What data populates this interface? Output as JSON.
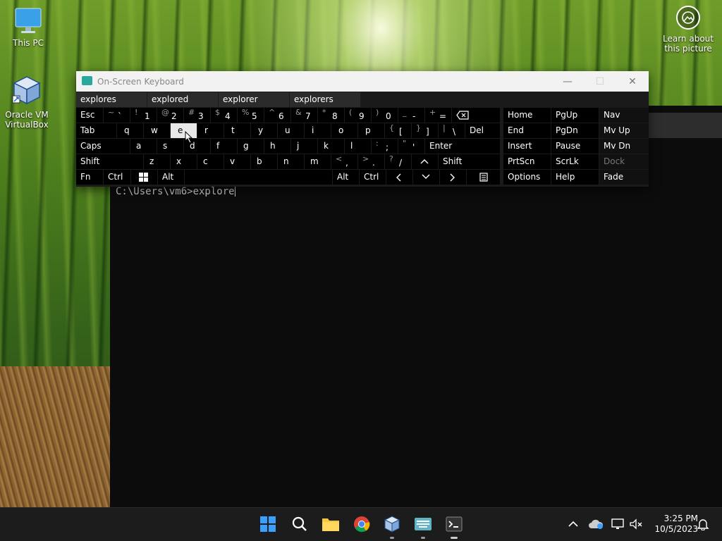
{
  "desktop": {
    "icons": [
      {
        "label": "This PC",
        "icon": "monitor-icon"
      },
      {
        "label": "Oracle VM VirtualBox",
        "icon": "virtualbox-cube-icon"
      }
    ],
    "learn_label": "Learn about this picture"
  },
  "console": {
    "prompt": "C:\\Users\\vm6>",
    "input": "explore"
  },
  "osk": {
    "title": "On-Screen Keyboard",
    "predictions": [
      "explores",
      "explored",
      "explorer",
      "explorers"
    ],
    "row1": {
      "esc": "Esc",
      "keys": [
        {
          "shift": "~",
          "main": "`"
        },
        {
          "shift": "!",
          "main": "1"
        },
        {
          "shift": "@",
          "main": "2"
        },
        {
          "shift": "#",
          "main": "3"
        },
        {
          "shift": "$",
          "main": "4"
        },
        {
          "shift": "%",
          "main": "5"
        },
        {
          "shift": "^",
          "main": "6"
        },
        {
          "shift": "&",
          "main": "7"
        },
        {
          "shift": "*",
          "main": "8"
        },
        {
          "shift": "(",
          "main": "9"
        },
        {
          "shift": ")",
          "main": "0"
        },
        {
          "shift": "_",
          "main": "-"
        },
        {
          "shift": "+",
          "main": "="
        }
      ]
    },
    "row2": {
      "tab": "Tab",
      "letters": [
        "q",
        "w",
        "e",
        "r",
        "t",
        "y",
        "u",
        "i",
        "o",
        "p"
      ],
      "brackets": [
        {
          "shift": "{",
          "main": "["
        },
        {
          "shift": "}",
          "main": "]"
        },
        {
          "shift": "|",
          "main": "\\"
        }
      ],
      "del": "Del"
    },
    "row3": {
      "caps": "Caps",
      "letters": [
        "a",
        "s",
        "d",
        "f",
        "g",
        "h",
        "j",
        "k",
        "l"
      ],
      "punct": [
        {
          "shift": ":",
          "main": ";"
        },
        {
          "shift": "\"",
          "main": "'"
        }
      ],
      "enter": "Enter"
    },
    "row4": {
      "shift": "Shift",
      "letters": [
        "z",
        "x",
        "c",
        "v",
        "b",
        "n",
        "m"
      ],
      "punct": [
        {
          "shift": "<",
          "main": ","
        },
        {
          "shift": ">",
          "main": "."
        },
        {
          "shift": "?",
          "main": "/"
        }
      ],
      "shift_right": "Shift"
    },
    "row5": {
      "fn": "Fn",
      "ctrl": "Ctrl",
      "alt": "Alt",
      "alt_right": "Alt",
      "ctrl_right": "Ctrl"
    },
    "pressed_key": "e",
    "nav_keys": [
      [
        "Home",
        "PgUp",
        "Nav"
      ],
      [
        "End",
        "PgDn",
        "Mv Up"
      ],
      [
        "Insert",
        "Pause",
        "Mv Dn"
      ],
      [
        "PrtScn",
        "ScrLk",
        "Dock"
      ],
      [
        "Options",
        "Help",
        "Fade"
      ]
    ]
  },
  "taskbar": {
    "apps": [
      "start-icon",
      "search-icon",
      "file-explorer-icon",
      "chrome-icon",
      "virtualbox-icon",
      "on-screen-keyboard-icon",
      "terminal-icon"
    ],
    "time": "3:25 PM",
    "date": "10/5/2023"
  },
  "colors": {
    "accent": "#0078d4",
    "console_bg": "#0c0c0c",
    "taskbar_bg": "#1c1c1c"
  }
}
